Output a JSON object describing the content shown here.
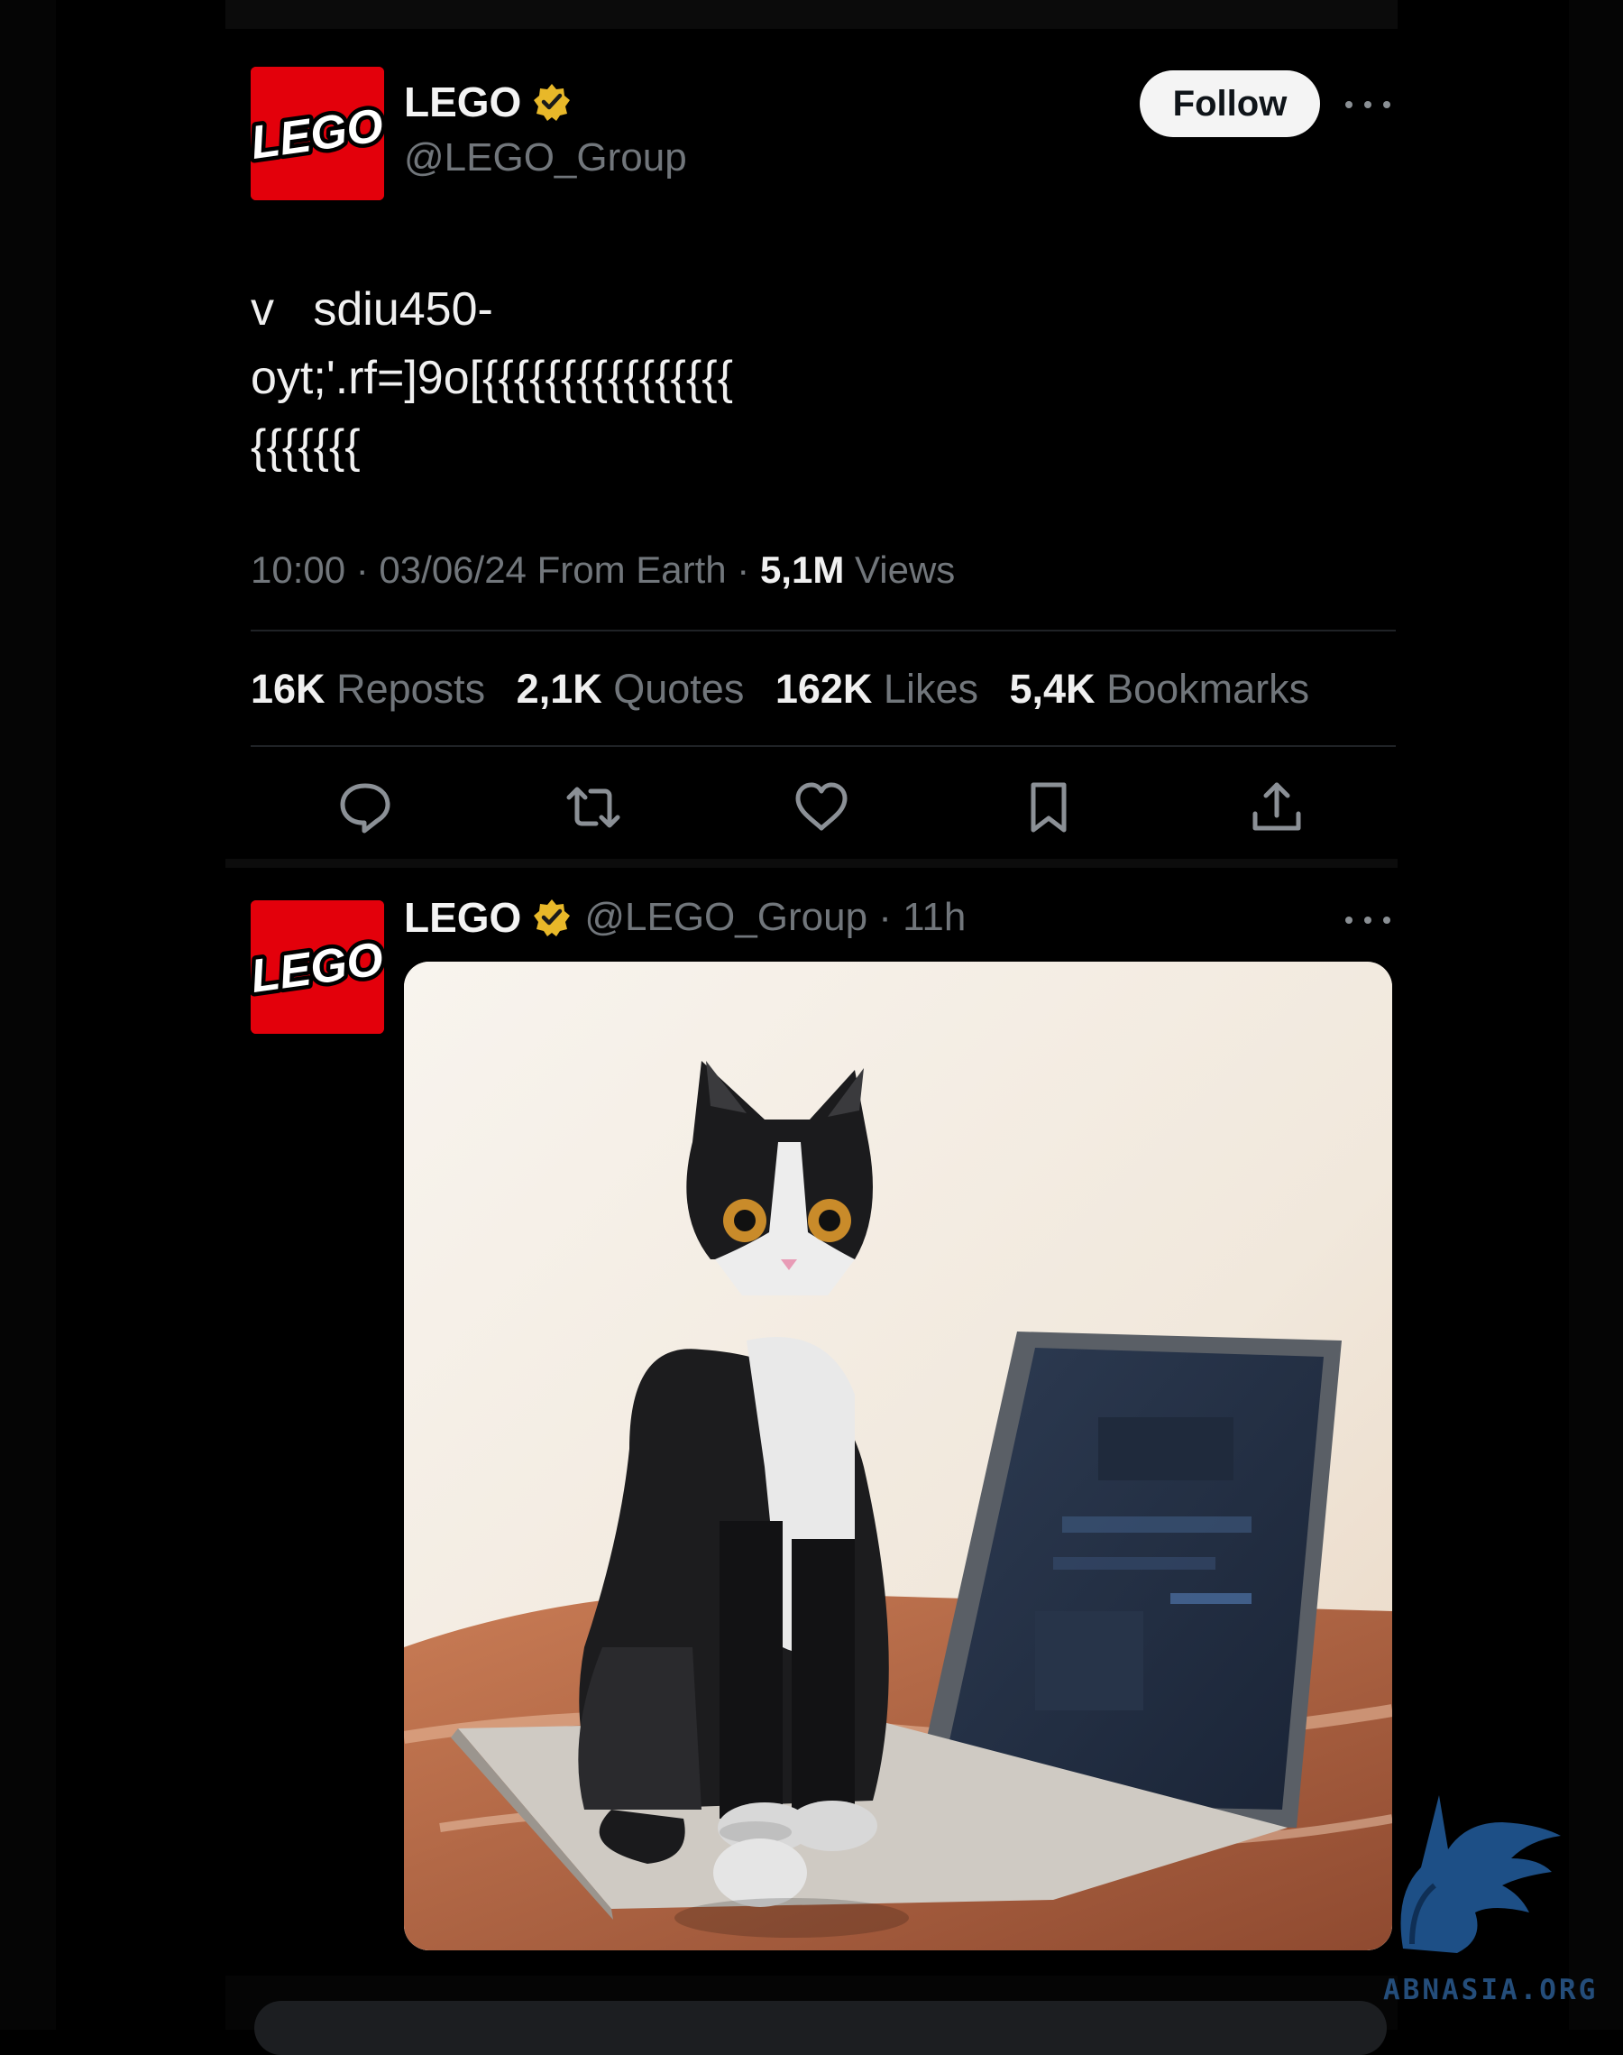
{
  "tweet": {
    "author_name": "LEGO",
    "author_handle": "@LEGO_Group",
    "logo_text": "LEGO",
    "follow_label": "Follow",
    "text_lines": [
      "v   sdiu450-",
      "oyt;'.rf=]9o[{{{{{{{{{{{{{{{{",
      "{{{{{{{"
    ],
    "timestamp": "10:00 · 03/06/24 From Earth · ",
    "views_count": "5,1M",
    "views_label": " Views",
    "stats": [
      {
        "count": "16K",
        "label": " Reposts"
      },
      {
        "count": "2,1K",
        "label": " Quotes"
      },
      {
        "count": "162K",
        "label": " Likes"
      },
      {
        "count": "5,4K",
        "label": " Bookmarks"
      }
    ],
    "actions": [
      "reply-icon",
      "repost-icon",
      "like-icon",
      "bookmark-icon",
      "share-icon"
    ]
  },
  "second_tweet": {
    "author_name": "LEGO",
    "handle_time": "@LEGO_Group · 11h",
    "logo_text": "LEGO",
    "media": "photo-lego-tuxedo-cat-on-laptop"
  },
  "watermark": {
    "text": "ABNASIA.ORG"
  },
  "colors": {
    "background": "#000000",
    "text_primary": "#e7e9ea",
    "text_secondary": "#71767b",
    "verified_gold": "#e8b829",
    "lego_red": "#e3000b"
  }
}
